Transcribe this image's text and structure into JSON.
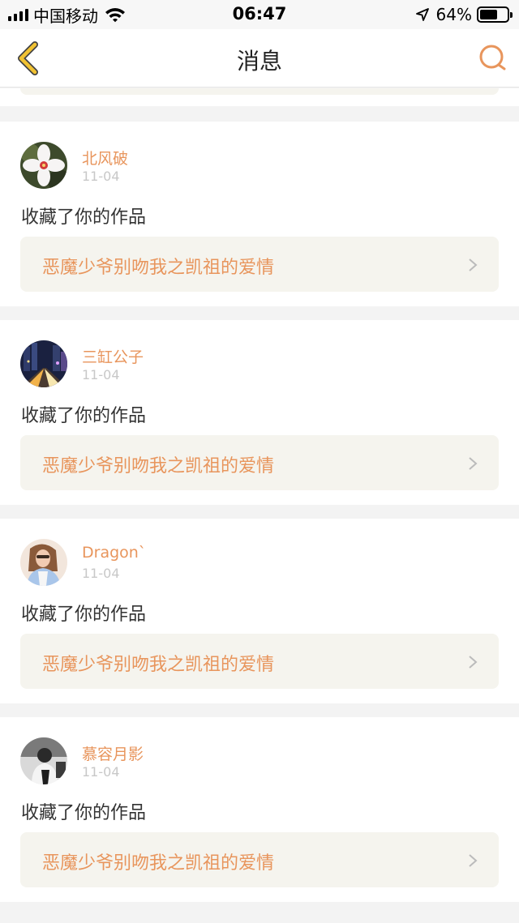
{
  "status_bar": {
    "carrier": "中国移动",
    "time": "06:47",
    "battery": "64%",
    "battery_level": 0.64,
    "icons": [
      "signal-icon",
      "wifi-icon",
      "location-arrow-icon",
      "battery-icon"
    ]
  },
  "nav": {
    "title": "消息",
    "back_icon": "chevron-left-icon",
    "search_icon": "search-icon"
  },
  "colors": {
    "accent": "#e8955c",
    "back_icon": "#f1c232",
    "link_bg": "#f5f4ee",
    "page_bg": "#f3f3f3",
    "date": "#c8c8c8"
  },
  "messages": [
    {
      "user": "北风破",
      "date": "11-04",
      "action": "收藏了你的作品",
      "work": "恶魔少爷别吻我之凯祖的爱情",
      "avatar": "flower-avatar"
    },
    {
      "user": "三缸公子",
      "date": "11-04",
      "action": "收藏了你的作品",
      "work": "恶魔少爷别吻我之凯祖的爱情",
      "avatar": "city-night-avatar"
    },
    {
      "user": "Dragon`",
      "date": "11-04",
      "action": "收藏了你的作品",
      "work": "恶魔少爷别吻我之凯祖的爱情",
      "avatar": "girl-avatar"
    },
    {
      "user": "慕容月影",
      "date": "11-04",
      "action": "收藏了你的作品",
      "work": "恶魔少爷别吻我之凯祖的爱情",
      "avatar": "person-avatar"
    }
  ]
}
